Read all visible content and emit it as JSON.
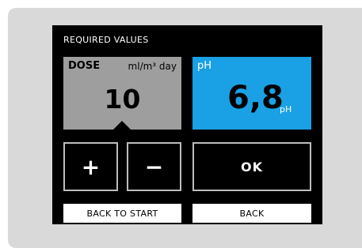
{
  "screen": {
    "title": "REQUIRED VALUES"
  },
  "dose": {
    "label": "DOSE",
    "unit": "ml/m³ day",
    "value": "10"
  },
  "ph": {
    "label": "pH",
    "value": "6,8",
    "unit": "pH"
  },
  "buttons": {
    "plus": "+",
    "minus": "−",
    "ok": "OK",
    "back_to_start": "BACK TO START",
    "back": "BACK"
  },
  "colors": {
    "background": "#d9d9d9",
    "screen": "#000000",
    "dose_tile": "#9e9e9e",
    "ph_tile": "#1aa0e4"
  }
}
